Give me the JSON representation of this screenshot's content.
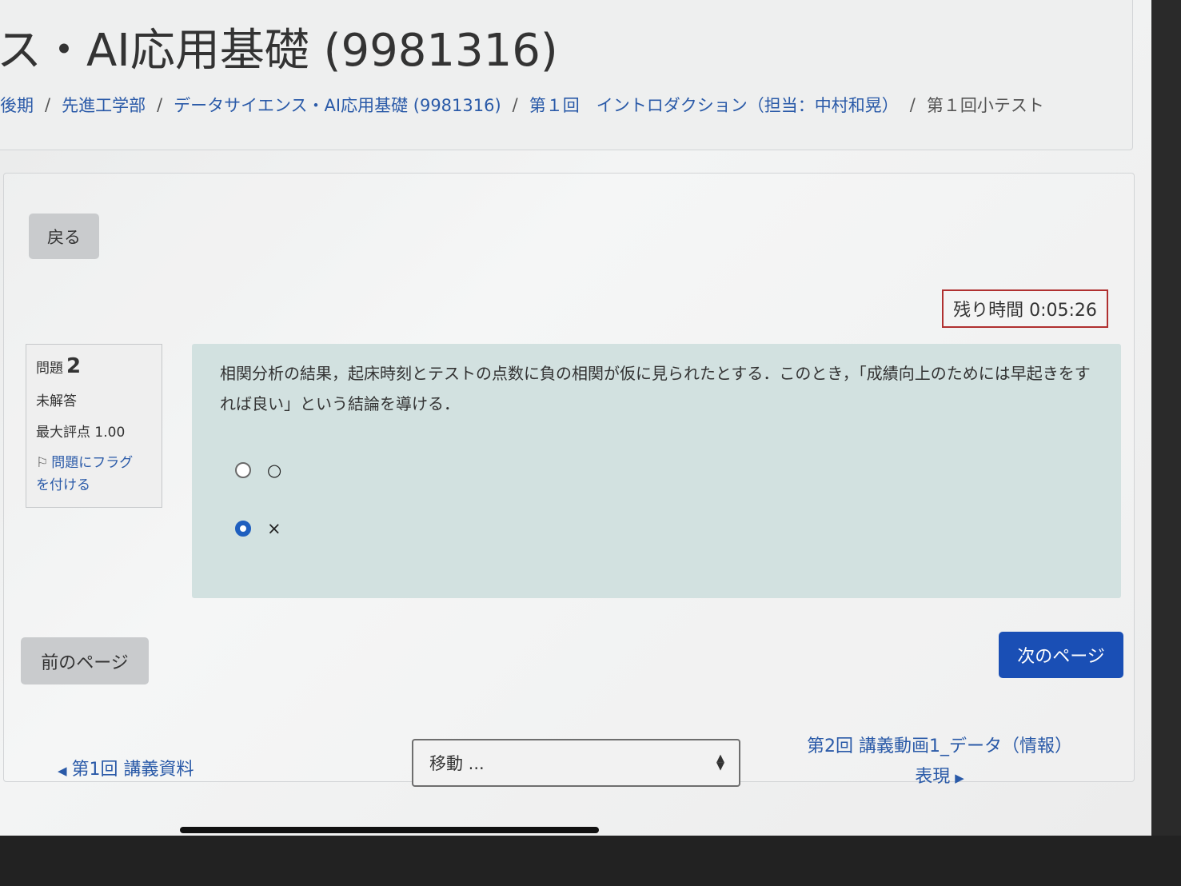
{
  "header": {
    "title": "ス・AI応用基礎 (9981316)",
    "breadcrumb": [
      "後期",
      "先進工学部",
      "データサイエンス・AI応用基礎 (9981316)",
      "第１回　イントロダクション（担当：中村和晃）",
      "第１回小テスト"
    ]
  },
  "back_button": "戻る",
  "timer": "残り時間 0:05:26",
  "question_info": {
    "label": "問題",
    "number": "2",
    "status": "未解答",
    "max_score": "最大評点 1.00",
    "flag_line1": "問題にフラグ",
    "flag_line2": "を付ける"
  },
  "question": {
    "text": "相関分析の結果，起床時刻とテストの点数に負の相関が仮に見られたとする．このとき，「成績向上のためには早起きをすれば良い」という結論を導ける．",
    "options": [
      {
        "label": "○",
        "selected": false
      },
      {
        "label": "×",
        "selected": true
      }
    ]
  },
  "nav": {
    "prev_page": "前のページ",
    "next_page": "次のページ",
    "prev_activity": "第1回 講義資料",
    "next_activity_line1": "第2回 講義動画1_データ（情報）",
    "next_activity_line2": "表現",
    "jump_select": "移動 ..."
  },
  "colors": {
    "accent": "#1a4fb5",
    "link": "#2a5aa8",
    "timer_border": "#b03030",
    "question_bg": "#d2e1e0"
  }
}
